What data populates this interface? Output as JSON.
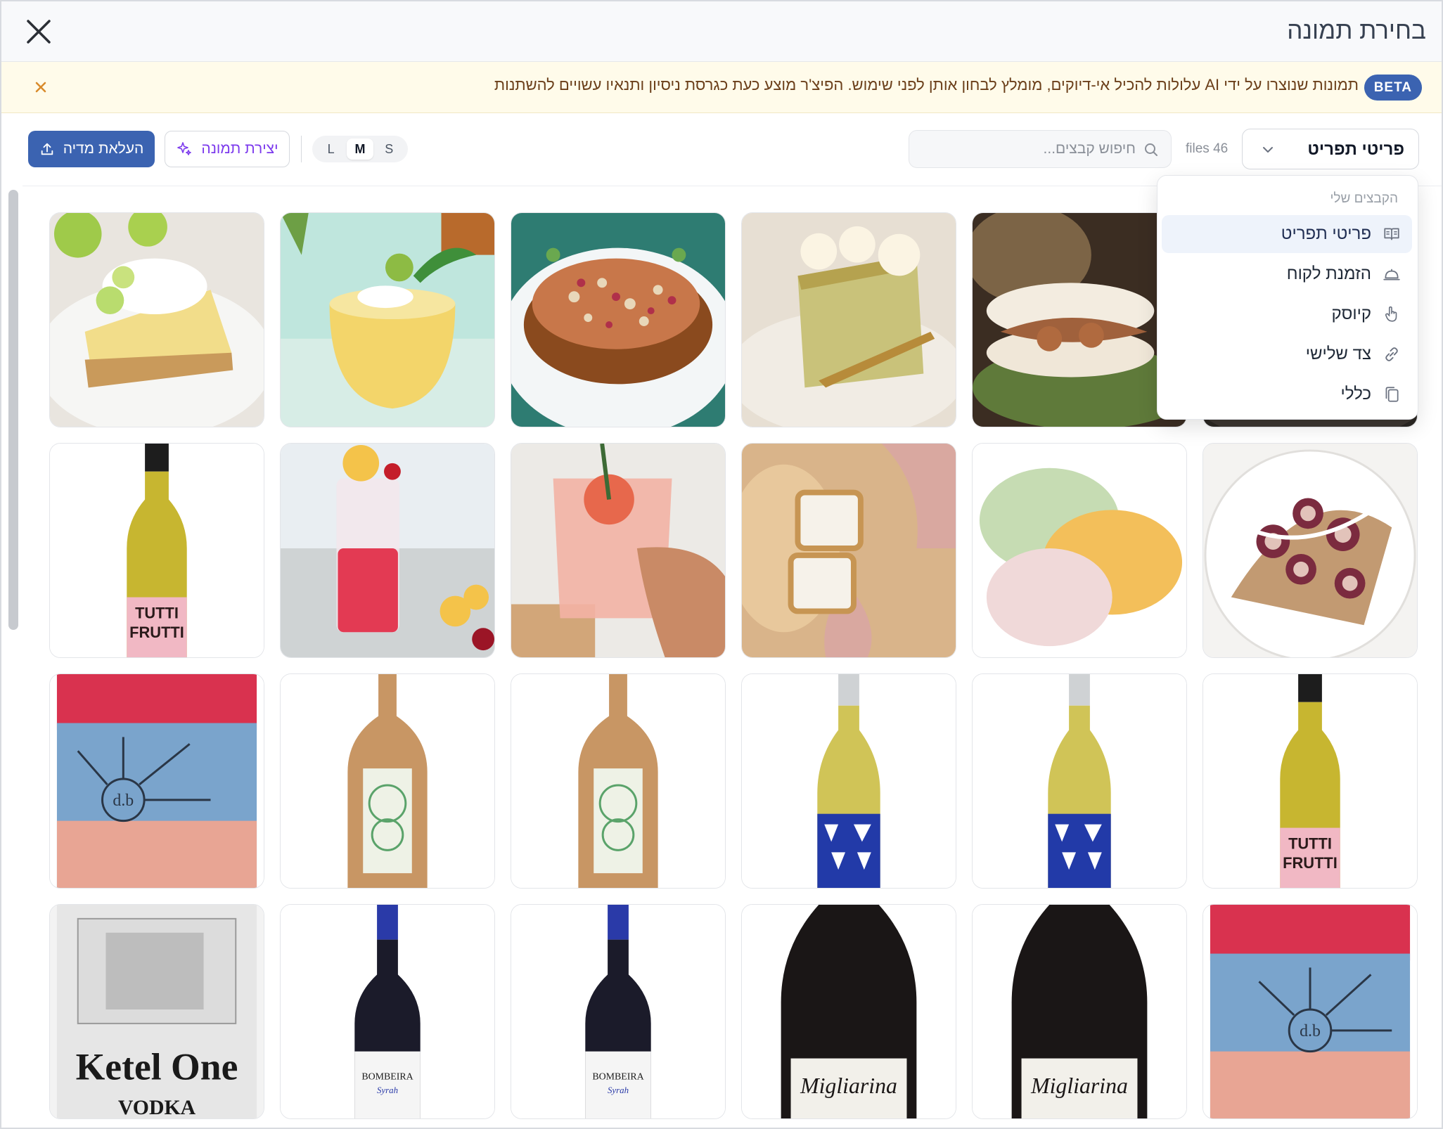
{
  "header": {
    "title": "בחירת תמונה"
  },
  "banner": {
    "badge": "BETA",
    "text": "תמונות שנוצרו על ידי AI עלולות להכיל אי-דיוקים, מומלץ לבחון אותן לפני שימוש. הפיצ'ר מוצע כעת כגרסת ניסיון ותנאיו עשויים להשתנות"
  },
  "toolbar": {
    "upload_label": "העלאת מדיה",
    "create_label": "יצירת תמונה",
    "sizes": [
      "L",
      "M",
      "S"
    ],
    "active_size": "M",
    "search_placeholder": "חיפוש קבצים...",
    "files_count": "files 46",
    "select_value": "פריטי תפריט"
  },
  "dropdown": {
    "group_label": "הקבצים שלי",
    "items": [
      {
        "label": "פריטי תפריט",
        "icon": "menu-book-icon",
        "active": true
      },
      {
        "label": "הזמנת לקוח",
        "icon": "cloche-icon",
        "active": false
      },
      {
        "label": "קיוסק",
        "icon": "pointer-hand-icon",
        "active": false
      },
      {
        "label": "צד שלישי",
        "icon": "link-icon",
        "active": false
      },
      {
        "label": "כללי",
        "icon": "copy-icon",
        "active": false
      }
    ]
  },
  "images": [
    "key-lime-pie",
    "yellow-cocktail-ice",
    "fried-fish-salad",
    "pistachio-cream-pie",
    "soft-shell-crab-bao",
    "hidden-dark-plate",
    "tutti-frutti-white-wine",
    "red-lemon-soda",
    "grapefruit-rosemary-cocktail",
    "fried-cheese-bites",
    "mochi-trio",
    "fig-crepe",
    "db-rose-wine-label",
    "clay-bottle-tree-label",
    "clay-bottle-tree-label",
    "blue-label-white-wine",
    "blue-label-white-wine",
    "tutti-frutti-white-wine",
    "ketel-one-vodka",
    "bombeira-syrah",
    "bombeira-syrah",
    "migliarina-red-wine",
    "migliarina-red-wine",
    "db-rose-wine-label"
  ],
  "labels": {
    "tutti_top": "TUTTI",
    "tutti_bottom": "FRUTTI",
    "ketel": "Ketel One",
    "vodka": "VODKA",
    "bombeira": "BOMBEIRA",
    "syrah": "Syrah",
    "migliarina": "Migliarina",
    "db": "d.b"
  },
  "colors": {
    "primary": "#3b63b1",
    "create_accent": "#7c3aed",
    "banner_bg": "#fffbea",
    "banner_text": "#6b3f1a"
  }
}
